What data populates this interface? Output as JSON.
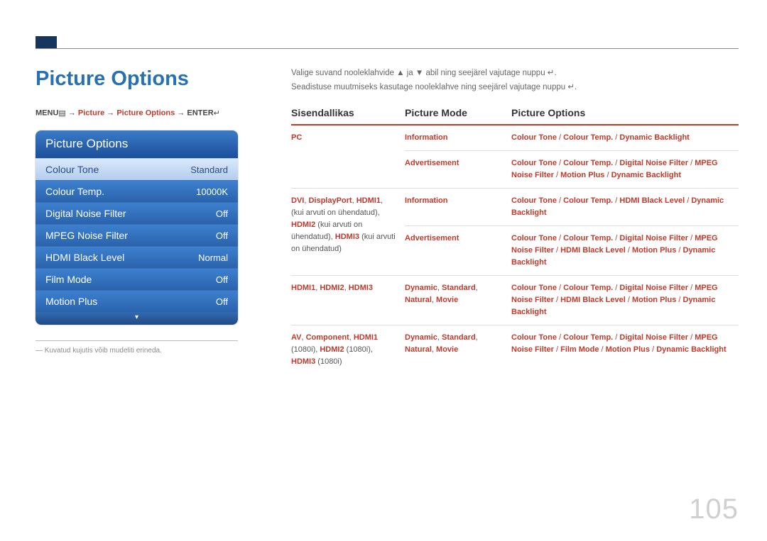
{
  "page_number": "105",
  "title": "Picture Options",
  "breadcrumb": {
    "menu": "MENU",
    "sep": " → ",
    "p1": "Picture",
    "p2": "Picture Options",
    "enter": "ENTER"
  },
  "osd": {
    "header": "Picture Options",
    "rows": [
      {
        "label": "Colour Tone",
        "value": "Standard",
        "selected": true
      },
      {
        "label": "Colour Temp.",
        "value": "10000K",
        "selected": false
      },
      {
        "label": "Digital Noise Filter",
        "value": "Off",
        "selected": false
      },
      {
        "label": "MPEG Noise Filter",
        "value": "Off",
        "selected": false
      },
      {
        "label": "HDMI Black Level",
        "value": "Normal",
        "selected": false
      },
      {
        "label": "Film Mode",
        "value": "Off",
        "selected": false
      },
      {
        "label": "Motion Plus",
        "value": "Off",
        "selected": false
      }
    ],
    "footer_arrow": "▾"
  },
  "footnote": "Kuvatud kujutis võib mudeliti erineda.",
  "instr1_a": "Valige suvand nooleklahvide ",
  "instr1_b": " ja ",
  "instr1_c": " abil ning seejärel vajutage nuppu ",
  "instr1_d": ".",
  "instr2_a": "Seadistuse muutmiseks kasutage nooleklahve ning seejärel vajutage nuppu ",
  "instr2_b": ".",
  "up": "▲",
  "down": "▼",
  "enter_glyph": "↵",
  "headers": {
    "h1": "Sisendallikas",
    "h2": "Picture Mode",
    "h3": "Picture Options"
  },
  "rows": [
    {
      "src_html": "<span class='red'>PC</span>",
      "mode_html": "<span class='red'>Information</span>",
      "opts_html": "<span class='red'>Colour Tone</span> <span class='slash'>/</span> <span class='red'>Colour Temp.</span> <span class='slash'>/</span> <span class='red'>Dynamic Backlight</span>"
    },
    {
      "src_html": "",
      "mode_html": "<span class='red'>Advertisement</span>",
      "opts_html": "<span class='red'>Colour Tone</span> <span class='slash'>/</span> <span class='red'>Colour Temp.</span> <span class='slash'>/</span> <span class='red'>Digital Noise Filter</span> <span class='slash'>/</span> <span class='red'>MPEG Noise Filter</span> <span class='slash'>/</span> <span class='red'>Motion Plus</span> <span class='slash'>/</span> <span class='red'>Dynamic Backlight</span>"
    },
    {
      "src_html": "<span class='red'>DVI</span>, <span class='red'>DisplayPort</span>, <span class='red'>HDMI1</span>,  (kui arvuti on ühendatud), <span class='red'>HDMI2</span> (kui arvuti on ühendatud), <span class='red'>HDMI3</span> (kui arvuti on ühendatud)",
      "mode_html": "<span class='red'>Information</span>",
      "opts_html": "<span class='red'>Colour Tone</span> <span class='slash'>/</span> <span class='red'>Colour Temp.</span> <span class='slash'>/</span> <span class='red'>HDMI Black Level</span> <span class='slash'>/</span> <span class='red'>Dynamic Backlight</span>"
    },
    {
      "src_html": "",
      "mode_html": "<span class='red'>Advertisement</span>",
      "opts_html": "<span class='red'>Colour Tone</span> <span class='slash'>/</span> <span class='red'>Colour Temp.</span> <span class='slash'>/</span> <span class='red'>Digital Noise Filter</span> <span class='slash'>/</span> <span class='red'>MPEG Noise Filter</span> <span class='slash'>/</span> <span class='red'>HDMI Black Level</span> <span class='slash'>/</span> <span class='red'>Motion Plus</span> <span class='slash'>/</span> <span class='red'>Dynamic Backlight</span>"
    },
    {
      "src_html": "<span class='red'>HDMI1</span>, <span class='red'>HDMI2</span>, <span class='red'>HDMI3</span>",
      "mode_html": "<span class='red'>Dynamic</span>, <span class='red'>Standard</span>, <span class='red'>Natural</span>, <span class='red'>Movie</span>",
      "opts_html": "<span class='red'>Colour Tone</span> <span class='slash'>/</span> <span class='red'>Colour Temp.</span> <span class='slash'>/</span> <span class='red'>Digital Noise Filter</span> <span class='slash'>/</span> <span class='red'>MPEG Noise Filter</span> <span class='slash'>/</span> <span class='red'>HDMI Black Level</span> <span class='slash'>/</span> <span class='red'>Motion Plus</span> <span class='slash'>/</span> <span class='red'>Dynamic Backlight</span>"
    },
    {
      "src_html": "<span class='red'>AV</span>, <span class='red'>Component</span>, <span class='red'>HDMI1</span> (1080i), <span class='red'>HDMI2</span> (1080i), <span class='red'>HDMI3</span> (1080i)",
      "mode_html": "<span class='red'>Dynamic</span>, <span class='red'>Standard</span>, <span class='red'>Natural</span>, <span class='red'>Movie</span>",
      "opts_html": "<span class='red'>Colour Tone</span> <span class='slash'>/</span> <span class='red'>Colour Temp.</span> <span class='slash'>/</span> <span class='red'>Digital Noise Filter</span> <span class='slash'>/</span> <span class='red'>MPEG Noise Filter</span> <span class='slash'>/</span> <span class='red'>Film Mode</span> <span class='slash'>/</span> <span class='red'>Motion Plus</span> <span class='slash'>/</span> <span class='red'>Dynamic Backlight</span>"
    }
  ]
}
